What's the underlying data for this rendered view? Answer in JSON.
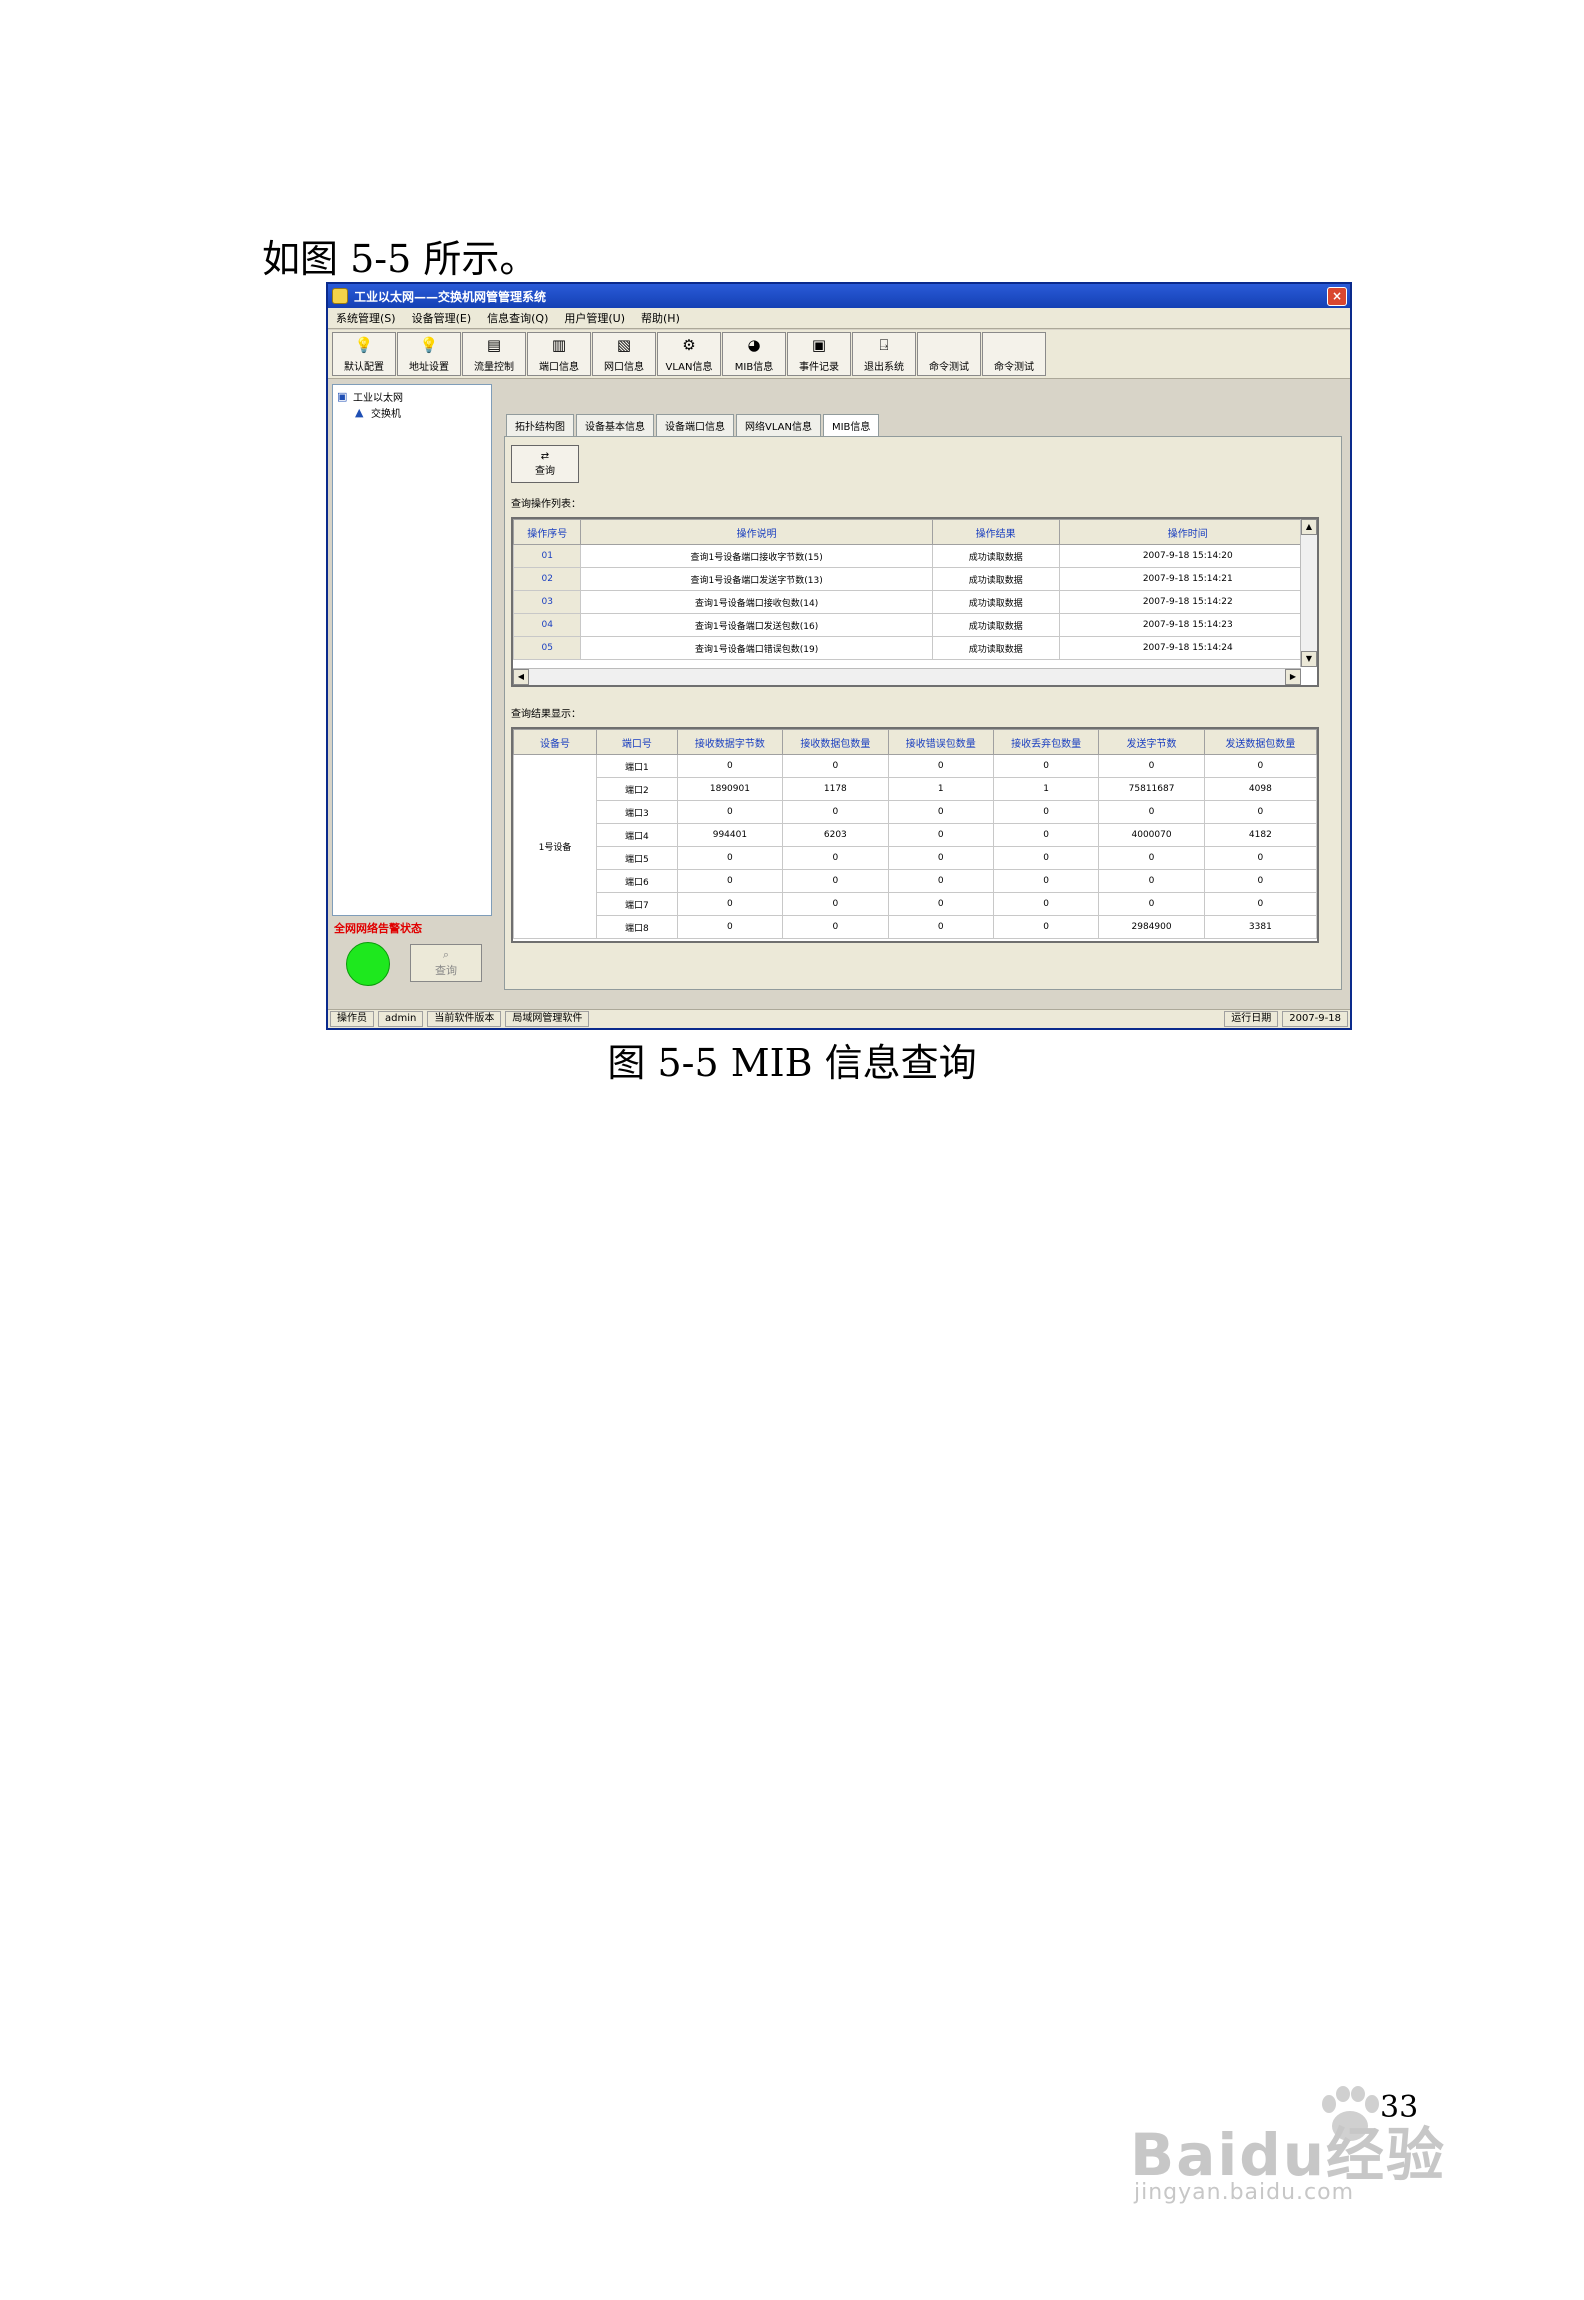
{
  "document": {
    "intro_text": "如图 5-5 所示。",
    "caption": "图 5-5 MIB 信息查询",
    "page_number": "33"
  },
  "window": {
    "title": "工业以太网——交换机网管管理系统",
    "close_label": "×",
    "menu": [
      "系统管理(S)",
      "设备管理(E)",
      "信息查询(Q)",
      "用户管理(U)",
      "帮助(H)"
    ],
    "toolbar": [
      {
        "label": "默认配置",
        "icon": "lightbulb-icon"
      },
      {
        "label": "地址设置",
        "icon": "lightbulb-icon"
      },
      {
        "label": "流量控制",
        "icon": "monitor-icon"
      },
      {
        "label": "端口信息",
        "icon": "printer-icon"
      },
      {
        "label": "网口信息",
        "icon": "document-icon"
      },
      {
        "label": "VLAN信息",
        "icon": "network-icon"
      },
      {
        "label": "MIB信息",
        "icon": "chart-icon"
      },
      {
        "label": "事件记录",
        "icon": "camera-icon"
      },
      {
        "label": "退出系统",
        "icon": "exit-icon"
      },
      {
        "label": "命令测试",
        "icon": "none"
      },
      {
        "label": "命令测试",
        "icon": "none"
      }
    ],
    "tree": {
      "root": "工业以太网",
      "child": "交换机"
    },
    "tabs": [
      "拓扑结构图",
      "设备基本信息",
      "设备端口信息",
      "网络VLAN信息",
      "MIB信息"
    ],
    "query_button": "查询",
    "history_section": "查询操作列表：",
    "history_columns": [
      "操作序号",
      "操作说明",
      "操作结果",
      "操作时间"
    ],
    "history_rows": [
      [
        "01",
        "查询1号设备端口接收字节数(15)",
        "成功读取数据",
        "2007-9-18 15:14:20"
      ],
      [
        "02",
        "查询1号设备端口发送字节数(13)",
        "成功读取数据",
        "2007-9-18 15:14:21"
      ],
      [
        "03",
        "查询1号设备端口接收包数(14)",
        "成功读取数据",
        "2007-9-18 15:14:22"
      ],
      [
        "04",
        "查询1号设备端口发送包数(16)",
        "成功读取数据",
        "2007-9-18 15:14:23"
      ],
      [
        "05",
        "查询1号设备端口错误包数(19)",
        "成功读取数据",
        "2007-9-18 15:14:24"
      ]
    ],
    "result_section": "查询结果显示：",
    "result_columns": [
      "设备号",
      "端口号",
      "接收数据字节数",
      "接收数据包数量",
      "接收错误包数量",
      "接收丢弃包数量",
      "发送字节数",
      "发送数据包数量"
    ],
    "device_label": "1号设备",
    "result_rows": [
      [
        "端口1",
        "0",
        "0",
        "0",
        "0",
        "0",
        "0"
      ],
      [
        "端口2",
        "1890901",
        "1178",
        "1",
        "1",
        "75811687",
        "4098"
      ],
      [
        "端口3",
        "0",
        "0",
        "0",
        "0",
        "0",
        "0"
      ],
      [
        "端口4",
        "994401",
        "6203",
        "0",
        "0",
        "4000070",
        "4182"
      ],
      [
        "端口5",
        "0",
        "0",
        "0",
        "0",
        "0",
        "0"
      ],
      [
        "端口6",
        "0",
        "0",
        "0",
        "0",
        "0",
        "0"
      ],
      [
        "端口7",
        "0",
        "0",
        "0",
        "0",
        "0",
        "0"
      ],
      [
        "端口8",
        "0",
        "0",
        "0",
        "0",
        "2984900",
        "3381"
      ]
    ],
    "network_status_label": "全网网络告警状态",
    "network_status_color": "#1ee81e",
    "status_query_button": "查询",
    "statusbar": [
      "操作员",
      "admin",
      "当前软件版本",
      "局域网管理软件",
      "运行日期",
      "2007-9-18"
    ]
  },
  "watermark": {
    "brand": "Baidu经验",
    "url": "jingyan.baidu.com"
  }
}
